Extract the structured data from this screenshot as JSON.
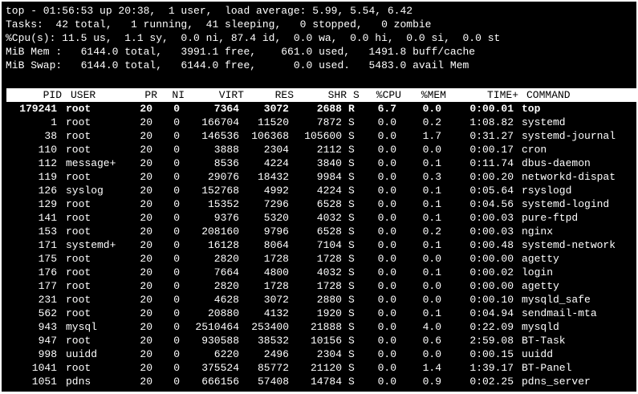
{
  "summary": {
    "line1": "top - 01:56:53 up 20:38,  1 user,  load average: 5.99, 5.54, 6.42",
    "line2": "Tasks:  42 total,   1 running,  41 sleeping,   0 stopped,   0 zombie",
    "line3": "%Cpu(s): 11.5 us,  1.1 sy,  0.0 ni, 87.4 id,  0.0 wa,  0.0 hi,  0.0 si,  0.0 st",
    "line4": "MiB Mem :   6144.0 total,   3991.1 free,    661.0 used,   1491.8 buff/cache",
    "line5": "MiB Swap:   6144.0 total,   6144.0 free,      0.0 used.   5483.0 avail Mem"
  },
  "headers": {
    "pid": "PID",
    "user": "USER",
    "pr": "PR",
    "ni": "NI",
    "virt": "VIRT",
    "res": "RES",
    "shr": "SHR",
    "s": "S",
    "cpu": "%CPU",
    "mem": "%MEM",
    "time": "TIME+",
    "command": "COMMAND"
  },
  "processes": [
    {
      "pid": "179241",
      "user": "root",
      "pr": "20",
      "ni": "0",
      "virt": "7364",
      "res": "3072",
      "shr": "2688",
      "s": "R",
      "cpu": "6.7",
      "mem": "0.0",
      "time": "0:00.01",
      "command": "top"
    },
    {
      "pid": "1",
      "user": "root",
      "pr": "20",
      "ni": "0",
      "virt": "166704",
      "res": "11520",
      "shr": "7872",
      "s": "S",
      "cpu": "0.0",
      "mem": "0.2",
      "time": "1:08.82",
      "command": "systemd"
    },
    {
      "pid": "38",
      "user": "root",
      "pr": "20",
      "ni": "0",
      "virt": "146536",
      "res": "106368",
      "shr": "105600",
      "s": "S",
      "cpu": "0.0",
      "mem": "1.7",
      "time": "0:31.27",
      "command": "systemd-journal"
    },
    {
      "pid": "110",
      "user": "root",
      "pr": "20",
      "ni": "0",
      "virt": "3888",
      "res": "2304",
      "shr": "2112",
      "s": "S",
      "cpu": "0.0",
      "mem": "0.0",
      "time": "0:00.17",
      "command": "cron"
    },
    {
      "pid": "112",
      "user": "message+",
      "pr": "20",
      "ni": "0",
      "virt": "8536",
      "res": "4224",
      "shr": "3840",
      "s": "S",
      "cpu": "0.0",
      "mem": "0.1",
      "time": "0:11.74",
      "command": "dbus-daemon"
    },
    {
      "pid": "119",
      "user": "root",
      "pr": "20",
      "ni": "0",
      "virt": "29076",
      "res": "18432",
      "shr": "9984",
      "s": "S",
      "cpu": "0.0",
      "mem": "0.3",
      "time": "0:00.20",
      "command": "networkd-dispat"
    },
    {
      "pid": "126",
      "user": "syslog",
      "pr": "20",
      "ni": "0",
      "virt": "152768",
      "res": "4992",
      "shr": "4224",
      "s": "S",
      "cpu": "0.0",
      "mem": "0.1",
      "time": "0:05.64",
      "command": "rsyslogd"
    },
    {
      "pid": "129",
      "user": "root",
      "pr": "20",
      "ni": "0",
      "virt": "15352",
      "res": "7296",
      "shr": "6528",
      "s": "S",
      "cpu": "0.0",
      "mem": "0.1",
      "time": "0:04.56",
      "command": "systemd-logind"
    },
    {
      "pid": "141",
      "user": "root",
      "pr": "20",
      "ni": "0",
      "virt": "9376",
      "res": "5320",
      "shr": "4032",
      "s": "S",
      "cpu": "0.0",
      "mem": "0.1",
      "time": "0:00.03",
      "command": "pure-ftpd"
    },
    {
      "pid": "153",
      "user": "root",
      "pr": "20",
      "ni": "0",
      "virt": "208160",
      "res": "9796",
      "shr": "6528",
      "s": "S",
      "cpu": "0.0",
      "mem": "0.2",
      "time": "0:00.03",
      "command": "nginx"
    },
    {
      "pid": "171",
      "user": "systemd+",
      "pr": "20",
      "ni": "0",
      "virt": "16128",
      "res": "8064",
      "shr": "7104",
      "s": "S",
      "cpu": "0.0",
      "mem": "0.1",
      "time": "0:00.48",
      "command": "systemd-network"
    },
    {
      "pid": "175",
      "user": "root",
      "pr": "20",
      "ni": "0",
      "virt": "2820",
      "res": "1728",
      "shr": "1728",
      "s": "S",
      "cpu": "0.0",
      "mem": "0.0",
      "time": "0:00.00",
      "command": "agetty"
    },
    {
      "pid": "176",
      "user": "root",
      "pr": "20",
      "ni": "0",
      "virt": "7664",
      "res": "4800",
      "shr": "4032",
      "s": "S",
      "cpu": "0.0",
      "mem": "0.1",
      "time": "0:00.02",
      "command": "login"
    },
    {
      "pid": "177",
      "user": "root",
      "pr": "20",
      "ni": "0",
      "virt": "2820",
      "res": "1728",
      "shr": "1728",
      "s": "S",
      "cpu": "0.0",
      "mem": "0.0",
      "time": "0:00.00",
      "command": "agetty"
    },
    {
      "pid": "231",
      "user": "root",
      "pr": "20",
      "ni": "0",
      "virt": "4628",
      "res": "3072",
      "shr": "2880",
      "s": "S",
      "cpu": "0.0",
      "mem": "0.0",
      "time": "0:00.10",
      "command": "mysqld_safe"
    },
    {
      "pid": "562",
      "user": "root",
      "pr": "20",
      "ni": "0",
      "virt": "20880",
      "res": "4132",
      "shr": "1920",
      "s": "S",
      "cpu": "0.0",
      "mem": "0.1",
      "time": "0:04.94",
      "command": "sendmail-mta"
    },
    {
      "pid": "943",
      "user": "mysql",
      "pr": "20",
      "ni": "0",
      "virt": "2510464",
      "res": "253400",
      "shr": "21888",
      "s": "S",
      "cpu": "0.0",
      "mem": "4.0",
      "time": "0:22.09",
      "command": "mysqld"
    },
    {
      "pid": "947",
      "user": "root",
      "pr": "20",
      "ni": "0",
      "virt": "930588",
      "res": "38532",
      "shr": "10156",
      "s": "S",
      "cpu": "0.0",
      "mem": "0.6",
      "time": "2:59.08",
      "command": "BT-Task"
    },
    {
      "pid": "998",
      "user": "uuidd",
      "pr": "20",
      "ni": "0",
      "virt": "6220",
      "res": "2496",
      "shr": "2304",
      "s": "S",
      "cpu": "0.0",
      "mem": "0.0",
      "time": "0:00.15",
      "command": "uuidd"
    },
    {
      "pid": "1041",
      "user": "root",
      "pr": "20",
      "ni": "0",
      "virt": "375524",
      "res": "85772",
      "shr": "21120",
      "s": "S",
      "cpu": "0.0",
      "mem": "1.4",
      "time": "1:39.17",
      "command": "BT-Panel"
    },
    {
      "pid": "1051",
      "user": "pdns",
      "pr": "20",
      "ni": "0",
      "virt": "666156",
      "res": "57408",
      "shr": "14784",
      "s": "S",
      "cpu": "0.0",
      "mem": "0.9",
      "time": "0:02.25",
      "command": "pdns_server"
    }
  ],
  "colors": {
    "background": "#000000",
    "foreground": "#ffffff",
    "header_bg": "#ffffff",
    "header_fg": "#000000"
  }
}
